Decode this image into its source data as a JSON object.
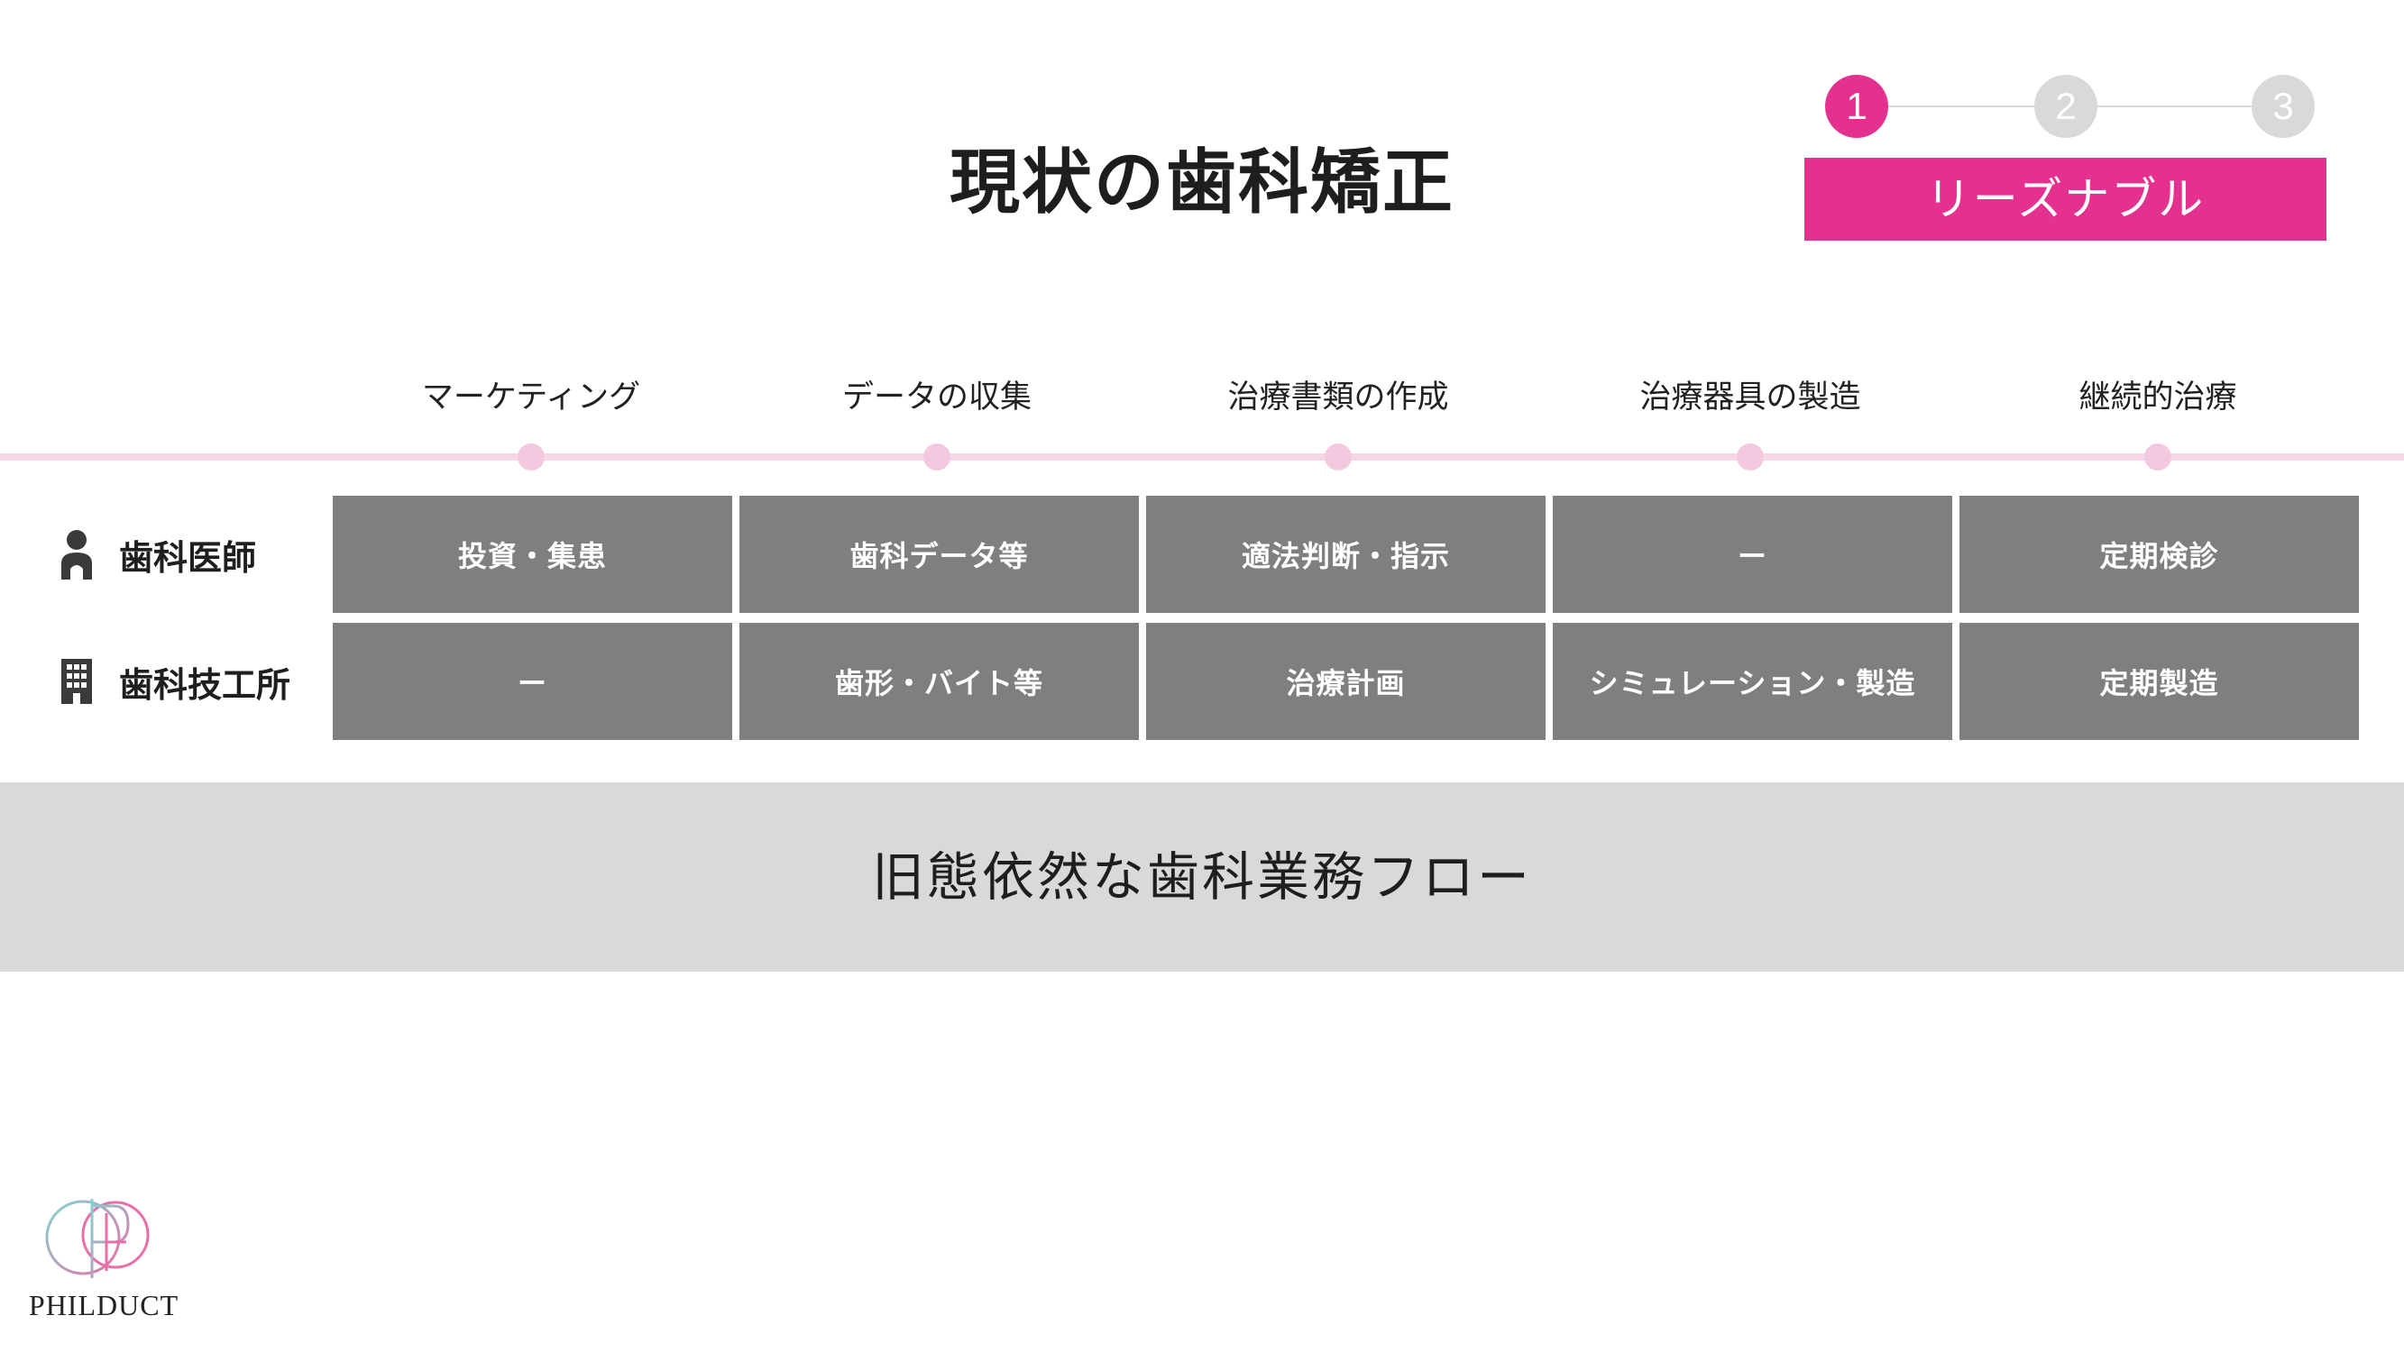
{
  "title": "現状の歯科矯正",
  "stepper": {
    "steps": [
      "1",
      "2",
      "3"
    ],
    "active_step": 1,
    "label": "リーズナブル"
  },
  "phases": [
    "マーケティング",
    "データの収集",
    "治療書類の作成",
    "治療器具の製造",
    "継続的治療"
  ],
  "rows": [
    {
      "label": "歯科医師",
      "icon": "person-icon",
      "cells": [
        "投資・集患",
        "歯科データ等",
        "適法判断・指示",
        "ー",
        "定期検診"
      ]
    },
    {
      "label": "歯科技工所",
      "icon": "building-icon",
      "cells": [
        "ー",
        "歯形・バイト等",
        "治療計画",
        "シミュレーション・製造",
        "定期製造"
      ]
    }
  ],
  "banner": "旧態依然な歯科業務フロー",
  "logo": {
    "text": "PHILDUCT"
  },
  "colors": {
    "accent": "#e4318f",
    "timeline": "#f6d7e7",
    "cell": "#7f7f7f",
    "banner": "#d9d9d9",
    "inactive_step": "#d9d9d9"
  }
}
